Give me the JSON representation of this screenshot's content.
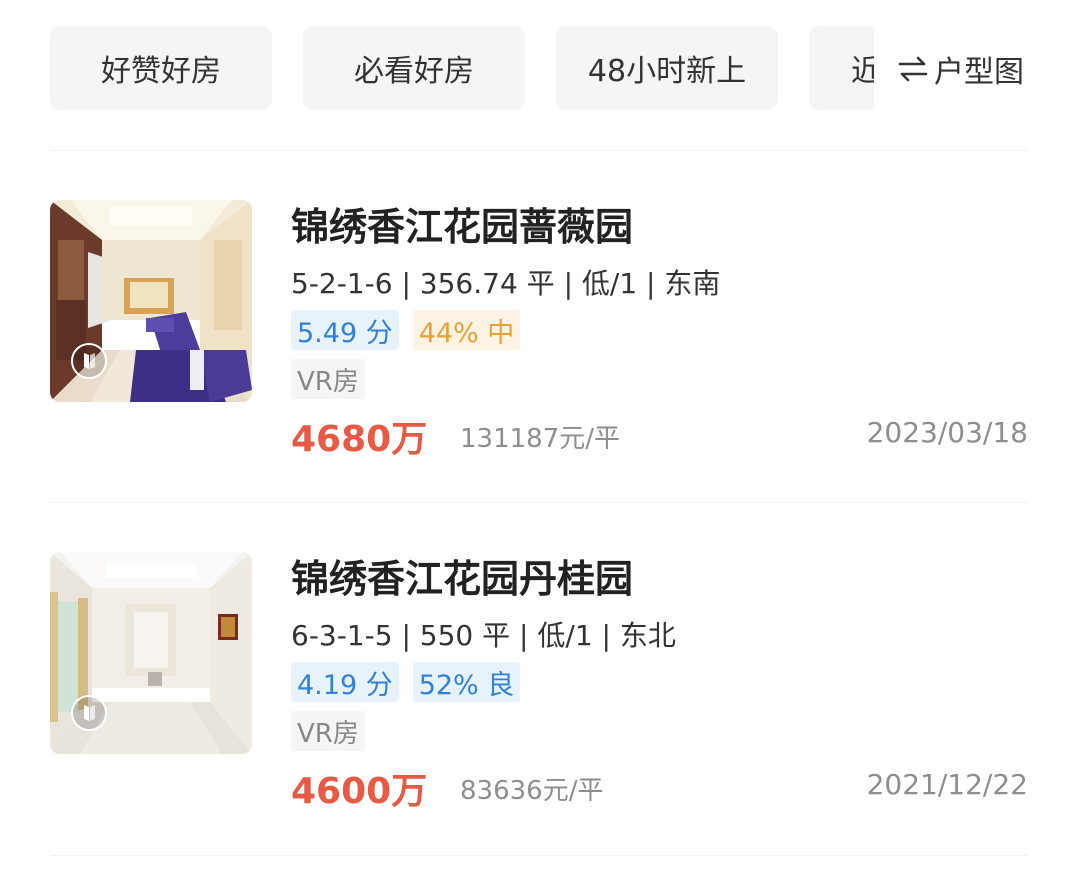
{
  "filters": {
    "chips": [
      "好赞好房",
      "必看好房",
      "48小时新上",
      "近"
    ],
    "layout_toggle_label": "户型图",
    "layout_toggle_icon": "swap-arrows-icon"
  },
  "listings": [
    {
      "title": "锦绣香江花园蔷薇园",
      "specs": "5-2-1-6 | 356.74 平 | 低/1 | 东南",
      "score": "5.49 分",
      "percentile": "44% 中",
      "percentile_style": "warn",
      "vr_tag": "VR房",
      "price": "4680万",
      "unit_price": "131187元/平",
      "date": "2023/03/18",
      "thumbnail_icon": "vr-play-icon"
    },
    {
      "title": "锦绣香江花园丹桂园",
      "specs": "6-3-1-5 | 550 平 | 低/1 | 东北",
      "score": "4.19 分",
      "percentile": "52% 良",
      "percentile_style": "good",
      "vr_tag": "VR房",
      "price": "4600万",
      "unit_price": "83636元/平",
      "date": "2021/12/22",
      "thumbnail_icon": "vr-play-icon"
    }
  ],
  "colors": {
    "price_red": "#e85a45",
    "score_blue": "#2f82d6",
    "warn_orange": "#e5a23b",
    "muted_gray": "#8e8e8e"
  }
}
